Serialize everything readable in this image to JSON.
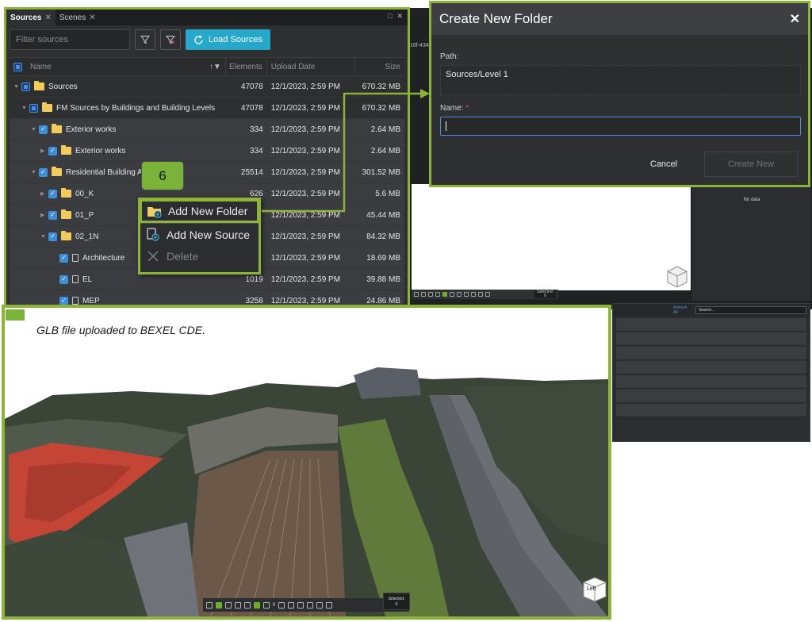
{
  "background": {
    "guid_fragment": "16f-434",
    "no_data": "No data",
    "toolbar_selected": "Selected:",
    "toolbar_selected_count": "0",
    "table_refresh": "Refresh All",
    "table_search": "Search..."
  },
  "sources_panel": {
    "tabs": [
      {
        "label": "Sources",
        "close": "✕"
      },
      {
        "label": "Scenes",
        "close": "✕"
      }
    ],
    "filter_placeholder": "Filter sources",
    "load_button": "Load Sources",
    "columns": {
      "name": "Name",
      "elements": "Elements",
      "upload_date": "Upload Date",
      "size": "Size"
    },
    "rows": [
      {
        "name": "Sources",
        "elements": "47078",
        "date": "12/1/2023, 2:59 PM",
        "size": "670.32 MB"
      },
      {
        "name": "FM Sources by Buildings and Building Levels",
        "elements": "47078",
        "date": "12/1/2023, 2:59 PM",
        "size": "670.32 MB"
      },
      {
        "name": "Exterior works",
        "elements": "334",
        "date": "12/1/2023, 2:59 PM",
        "size": "2.64 MB"
      },
      {
        "name": "Exterior works",
        "elements": "334",
        "date": "12/1/2023, 2:59 PM",
        "size": "2.64 MB"
      },
      {
        "name": "Residential Building A",
        "elements": "25514",
        "date": "12/1/2023, 2:59 PM",
        "size": "301.52 MB"
      },
      {
        "name": "00_K",
        "elements": "626",
        "date": "12/1/2023, 2:59 PM",
        "size": "5.6 MB"
      },
      {
        "name": "01_P",
        "elements": "",
        "date": "12/1/2023, 2:59 PM",
        "size": "45.44 MB"
      },
      {
        "name": "02_1N",
        "elements": "",
        "date": "12/1/2023, 2:59 PM",
        "size": "84.32 MB"
      },
      {
        "name": "Architecture",
        "elements": "",
        "date": "12/1/2023, 2:59 PM",
        "size": "18.69 MB"
      },
      {
        "name": "EL",
        "elements": "1019",
        "date": "12/1/2023, 2:59 PM",
        "size": "39.88 MB"
      },
      {
        "name": "MEP",
        "elements": "3258",
        "date": "12/1/2023, 2:59 PM",
        "size": "24.86 MB"
      }
    ]
  },
  "context_menu": {
    "step": "6",
    "items": [
      "Add New Folder",
      "Add New Source",
      "Delete"
    ]
  },
  "dialog": {
    "title": "Create New Folder",
    "close": "✕",
    "path_label": "Path:",
    "path_value": "Sources/Level 1",
    "name_label": "Name:",
    "name_required": "*",
    "cancel": "Cancel",
    "create": "Create New"
  },
  "viewer": {
    "caption": "GLB file uploaded to BEXEL CDE.",
    "toolbar_zero": "0",
    "selected_label": "Selected:",
    "selected_count": "0",
    "cube_face": "Left"
  },
  "colors": {
    "highlight_green": "#8db33b",
    "accent_blue": "#25a8c9",
    "panel_dark": "#2d2f31"
  }
}
